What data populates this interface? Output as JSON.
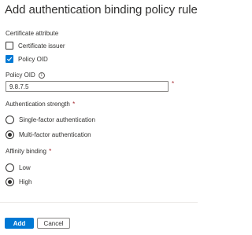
{
  "dialog": {
    "title": "Add authentication binding policy rule"
  },
  "certificate_attribute": {
    "label": "Certificate attribute",
    "options": [
      {
        "label": "Certificate issuer",
        "checked": false
      },
      {
        "label": "Policy OID",
        "checked": true
      }
    ]
  },
  "policy_oid": {
    "label": "Policy OID",
    "value": "9.8.7.5",
    "required_marker": "*"
  },
  "authentication_strength": {
    "label": "Authentication strength",
    "required_marker": "*",
    "options": [
      {
        "label": "Single-factor authentication",
        "selected": false
      },
      {
        "label": "Multi-factor authentication",
        "selected": true
      }
    ]
  },
  "affinity_binding": {
    "label": "Affinity binding",
    "required_marker": "*",
    "options": [
      {
        "label": "Low",
        "selected": false
      },
      {
        "label": "High",
        "selected": true
      }
    ]
  },
  "footer": {
    "add_label": "Add",
    "cancel_label": "Cancel"
  },
  "colors": {
    "primary": "#0078d4",
    "required": "#a4262c",
    "text": "#323130"
  }
}
